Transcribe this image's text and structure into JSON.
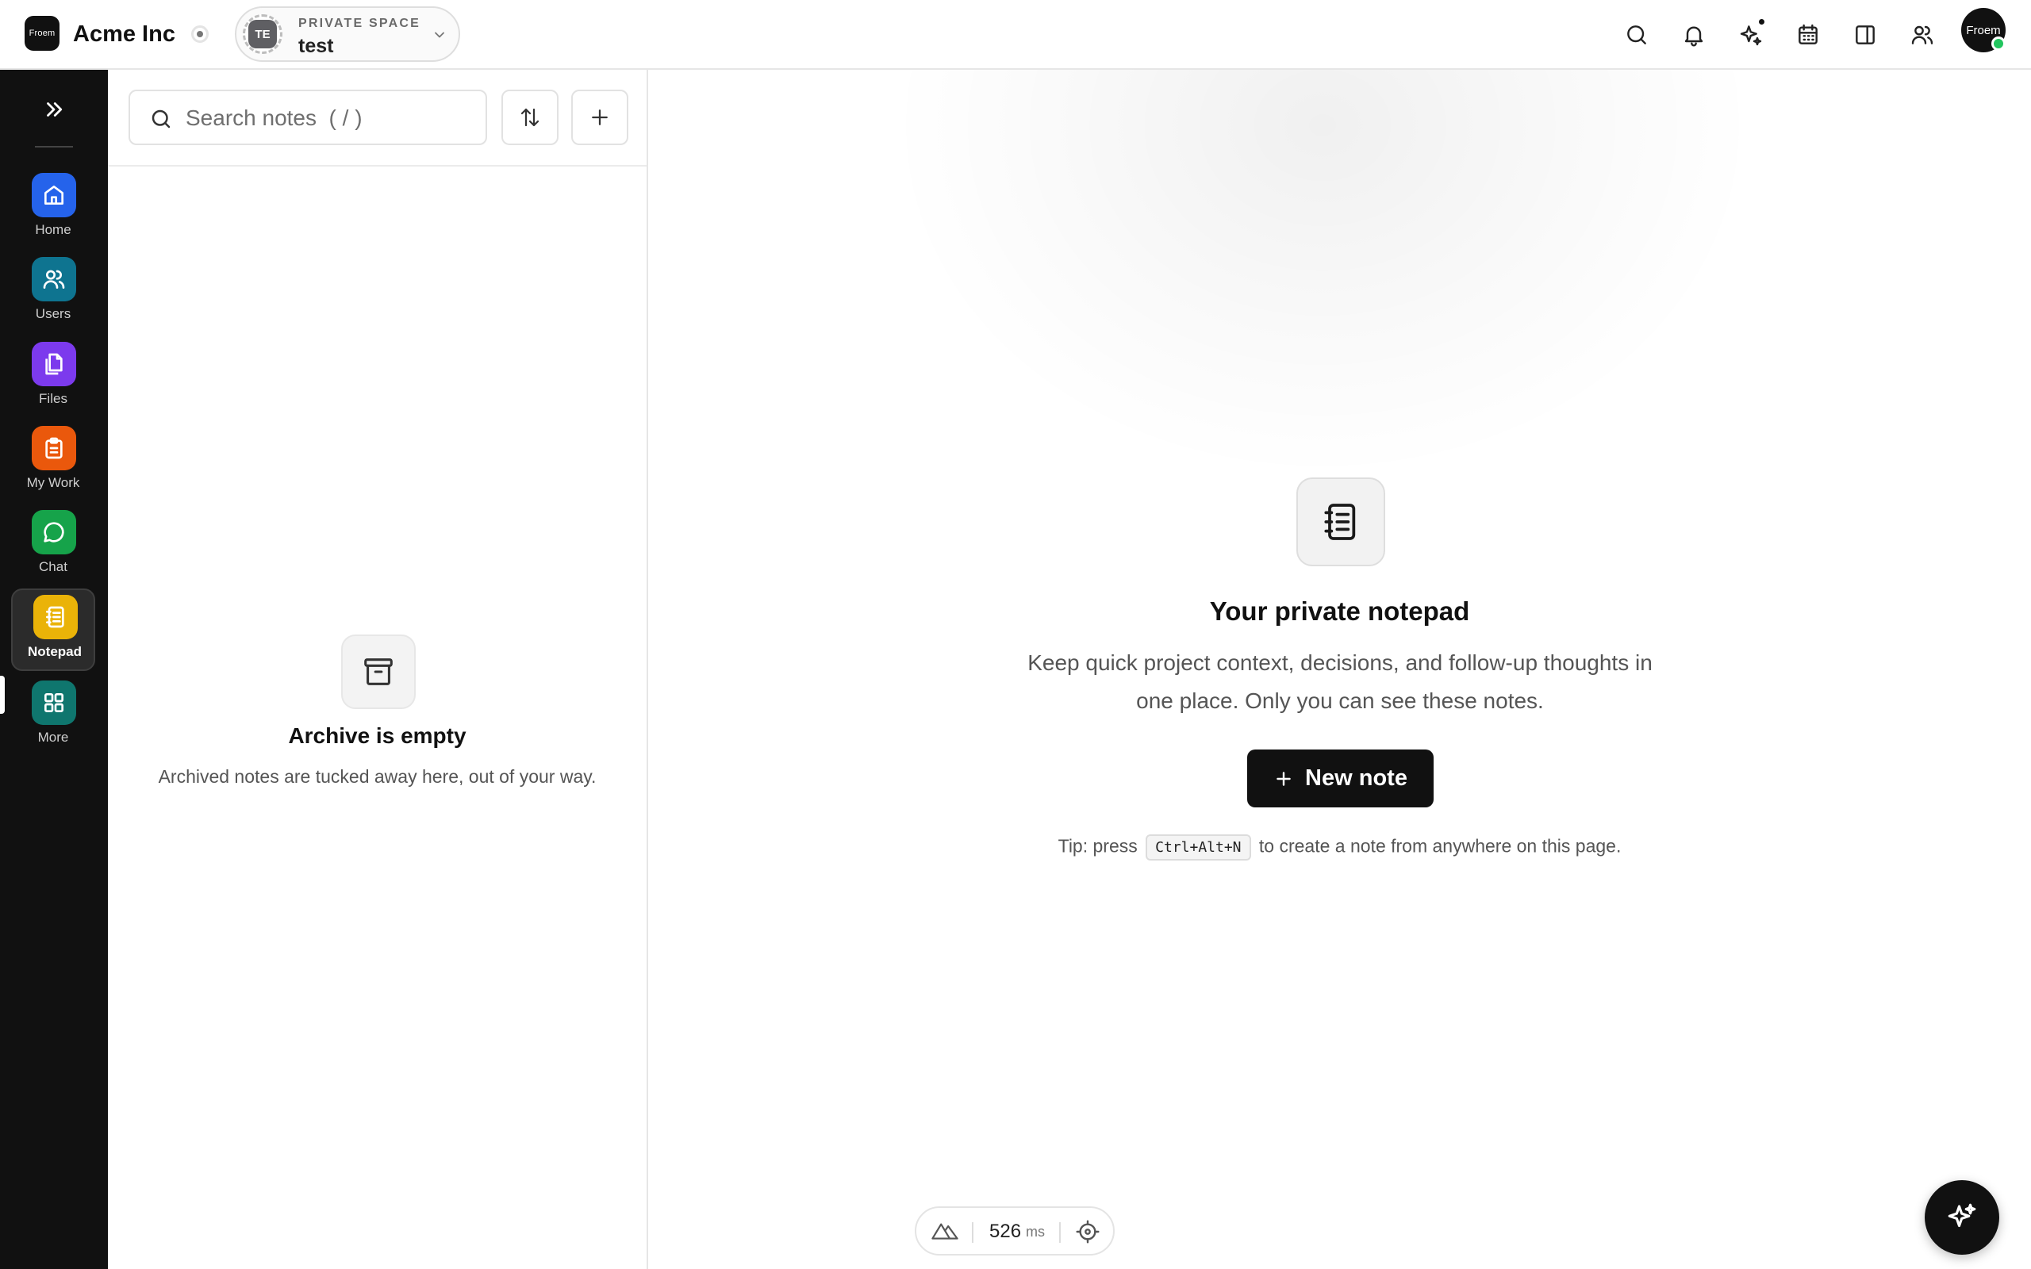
{
  "app": {
    "logo_text": "Froem",
    "org_name": "Acme Inc"
  },
  "space": {
    "kicker": "PRIVATE SPACE",
    "name": "test",
    "initials": "TE"
  },
  "top_icons": [
    "search-icon",
    "bell-icon",
    "sparkles-icon",
    "calendar-icon",
    "panel-icon",
    "people-icon"
  ],
  "user": {
    "avatar_text": "Froem",
    "status": "online"
  },
  "sidebar": {
    "items": [
      {
        "label": "Home",
        "icon": "home-icon",
        "color": "#2563eb"
      },
      {
        "label": "Users",
        "icon": "users-icon",
        "color": "#0e7490"
      },
      {
        "label": "Files",
        "icon": "files-icon",
        "color": "#7c3aed"
      },
      {
        "label": "My Work",
        "icon": "clipboard-icon",
        "color": "#ea580c"
      },
      {
        "label": "Chat",
        "icon": "chat-icon",
        "color": "#16a34a"
      },
      {
        "label": "Notepad",
        "icon": "notepad-icon",
        "color": "#eab308",
        "active": true
      },
      {
        "label": "More",
        "icon": "grid-icon",
        "color": "#0f766e"
      }
    ]
  },
  "notes_list": {
    "search_placeholder": "Search notes  ( / )",
    "empty_title": "Archive is empty",
    "empty_subtitle": "Archived notes are tucked away here, out of your way."
  },
  "main": {
    "title": "Your private notepad",
    "description": "Keep quick project context, decisions, and follow-up thoughts in one place. Only you can see these notes.",
    "new_note_label": "New note",
    "tip_prefix": "Tip: press",
    "tip_shortcut": "Ctrl+Alt+N",
    "tip_suffix": "to create a note from anywhere on this page."
  },
  "status_pill": {
    "value": "526",
    "unit": "ms"
  },
  "colors": {
    "rail_bg": "#111111",
    "primary_button": "#111111",
    "online": "#22c55e"
  }
}
